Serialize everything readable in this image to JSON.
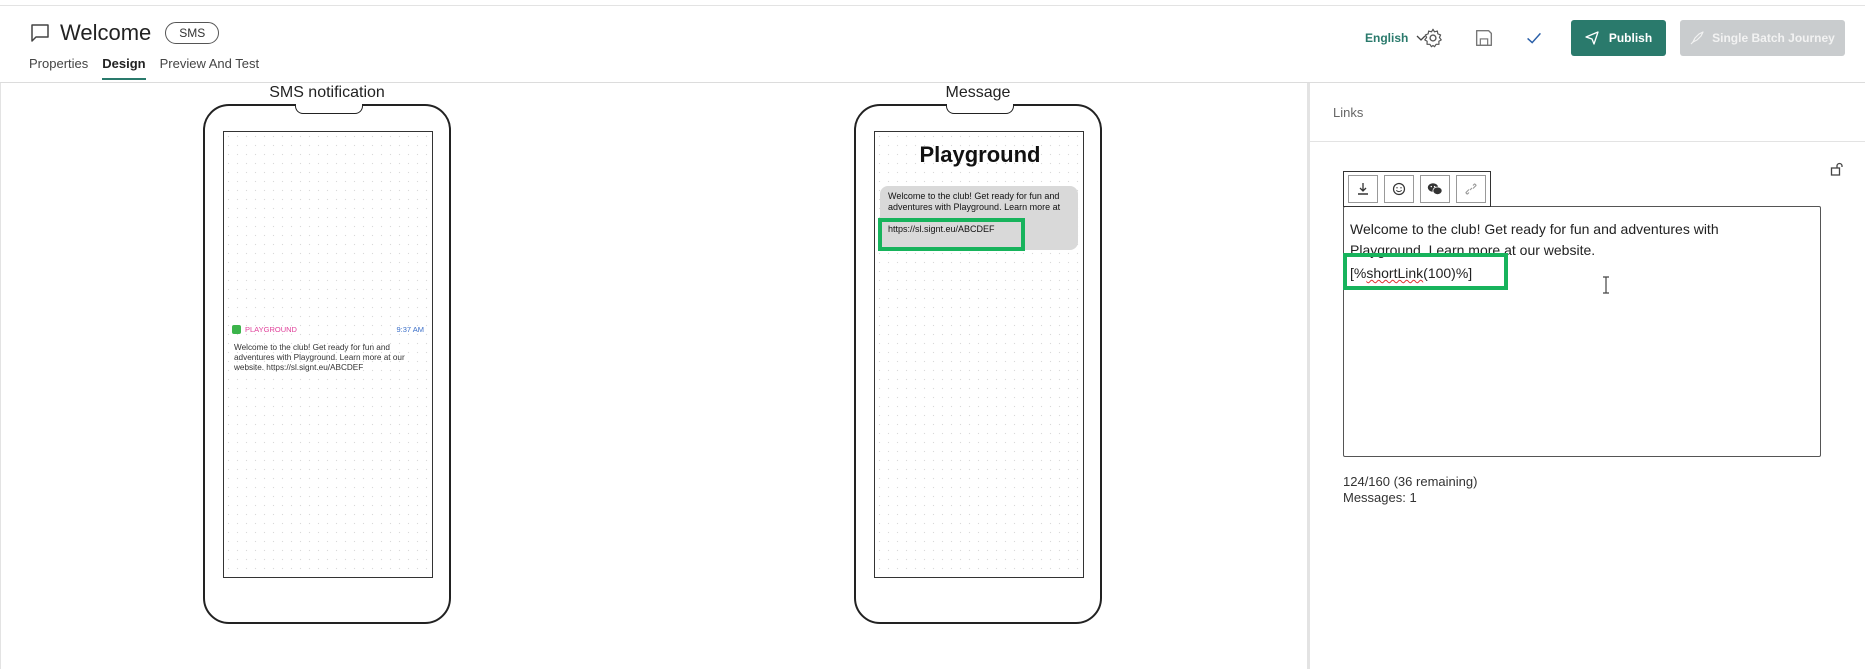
{
  "header": {
    "title": "Welcome",
    "badge": "SMS",
    "tabs": [
      {
        "label": "Properties",
        "active": false
      },
      {
        "label": "Design",
        "active": true
      },
      {
        "label": "Preview And Test",
        "active": false
      }
    ],
    "language": "English",
    "publish_label": "Publish",
    "batch_label": "Single Batch Journey"
  },
  "previews": {
    "sms": {
      "label": "SMS notification",
      "app_name": "PLAYGROUND",
      "time": "9:37 AM",
      "body": "Welcome to the club! Get ready for fun and adventures with Playground. Learn more at our website. https://sl.signt.eu/ABCDEF"
    },
    "message": {
      "label": "Message",
      "title": "Playground",
      "bubble_text": "Welcome to the club! Get ready for fun and adventures with Playground. Learn more at our website.",
      "link": "https://sl.signt.eu/ABCDEF"
    }
  },
  "panel": {
    "title": "Links",
    "editor_text": "Welcome to the club! Get ready for fun and adventures with Playground. Learn more at our website.",
    "field_open": "[%",
    "field_name": "shortLink",
    "field_close": "(100)%]",
    "counter": "124/160 (36 remaining)",
    "messages": "Messages: 1"
  },
  "colors": {
    "accent": "#2a7a6c",
    "highlight": "#17b35c",
    "disabled": "#c9ccce"
  }
}
